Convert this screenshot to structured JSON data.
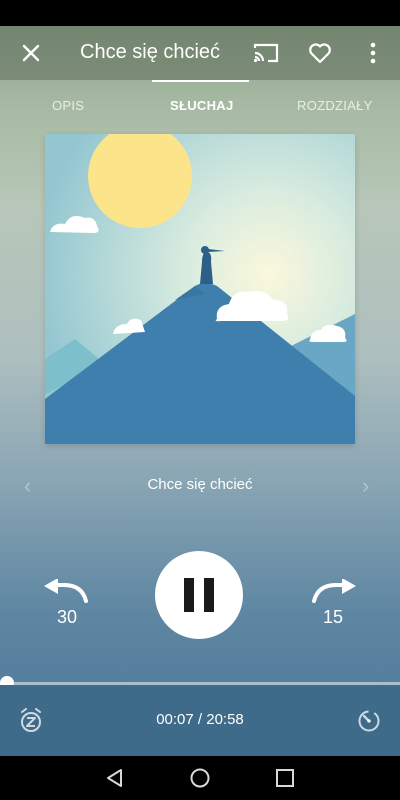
{
  "header": {
    "title": "Chce się chcieć"
  },
  "tabs": [
    {
      "label": "OPIS"
    },
    {
      "label": "SŁUCHAJ"
    },
    {
      "label": "ROZDZIAŁY"
    }
  ],
  "player": {
    "track_title": "Chce się chcieć",
    "rewind_seconds": "30",
    "forward_seconds": "15",
    "time_display": "00:07 / 20:58",
    "progress_fraction": 0.0056
  },
  "icons": {
    "close": "close-icon",
    "cast": "cast-icon",
    "favorite": "heart-icon",
    "more": "more-vert-icon",
    "sleep_timer": "sleep-timer-icon",
    "speed": "speed-icon"
  },
  "colors": {
    "bottom_bar": "#3f6b8b",
    "cover_mountain": "#3f7fae",
    "sun": "#fbe48a"
  }
}
